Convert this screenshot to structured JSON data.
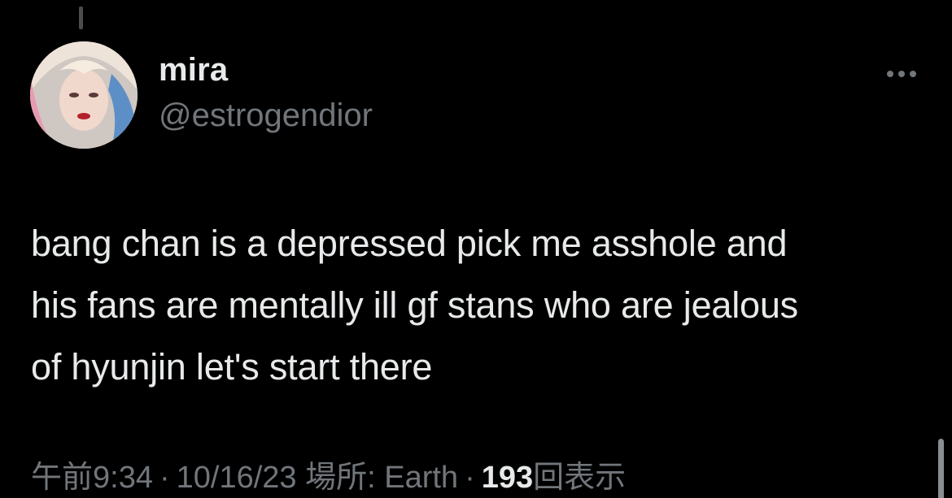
{
  "author": {
    "display_name": "mira",
    "handle": "@estrogendior"
  },
  "tweet": {
    "lines": [
      "bang chan is a depressed pick me asshole and",
      "his fans are mentally ill gf stans who are jealous",
      "of hyunjin let's start there"
    ]
  },
  "meta": {
    "time": "午前9:34",
    "date": "10/16/23",
    "location": "場所: Earth",
    "views_count": "193",
    "views_label": "回表示",
    "separator": "·"
  },
  "icons": {
    "more": "more-horizontal-icon"
  },
  "colors": {
    "background": "#000000",
    "primary_text": "#e7e9ea",
    "secondary_text": "#71767b"
  }
}
